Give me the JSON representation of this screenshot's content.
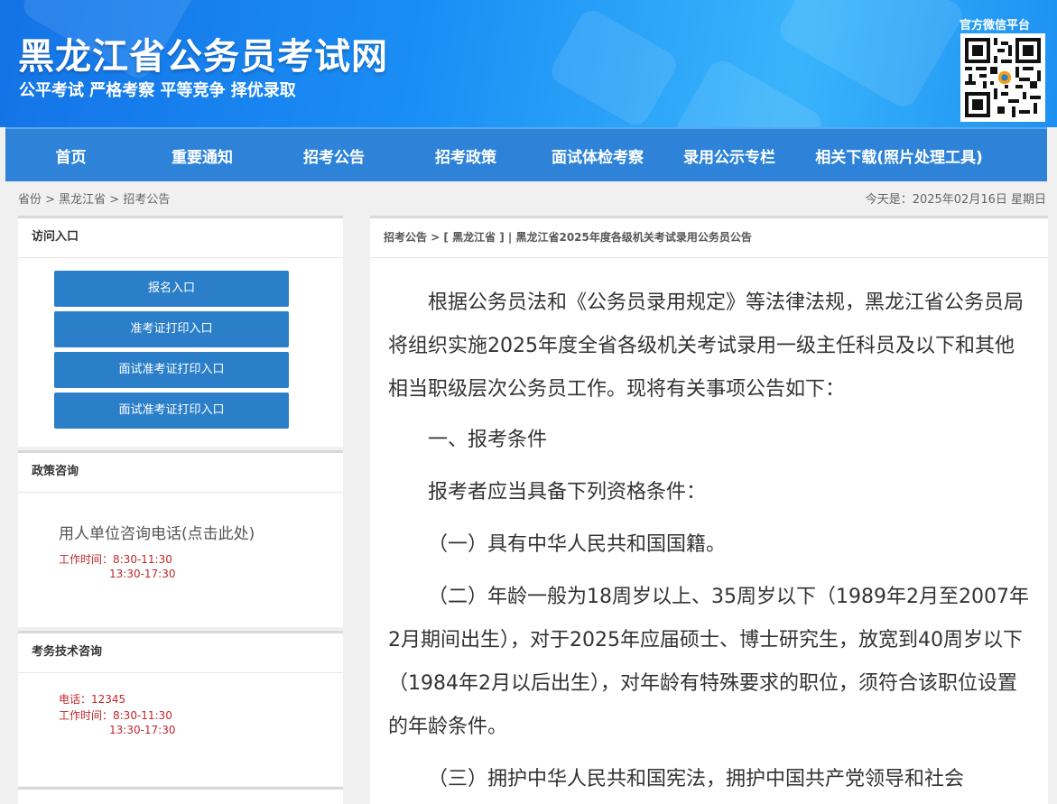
{
  "header": {
    "site_title": "黑龙江省公务员考试网",
    "slogan": "公平考试 严格考察 平等竞争 择优录取",
    "wechat_label": "官方微信平台"
  },
  "nav": {
    "items": [
      {
        "label": "首页"
      },
      {
        "label": "重要通知"
      },
      {
        "label": "招考公告"
      },
      {
        "label": "招考政策"
      },
      {
        "label": "面试体检考察"
      },
      {
        "label": "录用公示专栏"
      },
      {
        "label": "相关下载(照片处理工具)"
      }
    ]
  },
  "breadcrumb": {
    "text": "省份 > 黑龙江省  > 招考公告"
  },
  "date": "今天是：2025年02月16日 星期日",
  "sidebar": {
    "access": {
      "title": "访问入口",
      "buttons": [
        "报名入口",
        "准考证打印入口",
        "面试准考证打印入口",
        "面试准考证打印入口"
      ]
    },
    "policy": {
      "title": "政策咨询",
      "link": "用人单位咨询电话(点击此处)",
      "hours_label": "工作时间：8:30-11:30",
      "hours_2": "13:30-17:30"
    },
    "tech": {
      "title": "考务技术咨询",
      "phone": "电话：12345",
      "hours_label": "工作时间：8:30-11:30",
      "hours_2": "13:30-17:30"
    }
  },
  "main": {
    "breadcrumb": "招考公告 > [ 黑龙江省 ] | 黑龙江省2025年度各级机关考试录用公务员公告",
    "paragraphs": [
      "根据公务员法和《公务员录用规定》等法律法规，黑龙江省公务员局将组织实施2025年度全省各级机关考试录用一级主任科员及以下和其他相当职级层次公务员工作。现将有关事项公告如下：",
      "一、报考条件",
      "报考者应当具备下列资格条件：",
      "（一）具有中华人民共和国国籍。",
      "（二）年龄一般为18周岁以上、35周岁以下（1989年2月至2007年2月期间出生），对于2025年应届硕士、博士研究生，放宽到40周岁以下（1984年2月以后出生），对年龄有特殊要求的职位，须符合该职位设置的年龄条件。",
      "（三）拥护中华人民共和国宪法，拥护中国共产党领导和社会"
    ]
  },
  "colors": {
    "header_blue": "#1a8ef5",
    "nav_blue": "#2e83d9",
    "button_blue": "#2b7fc9",
    "hours_red": "#c0282d"
  }
}
